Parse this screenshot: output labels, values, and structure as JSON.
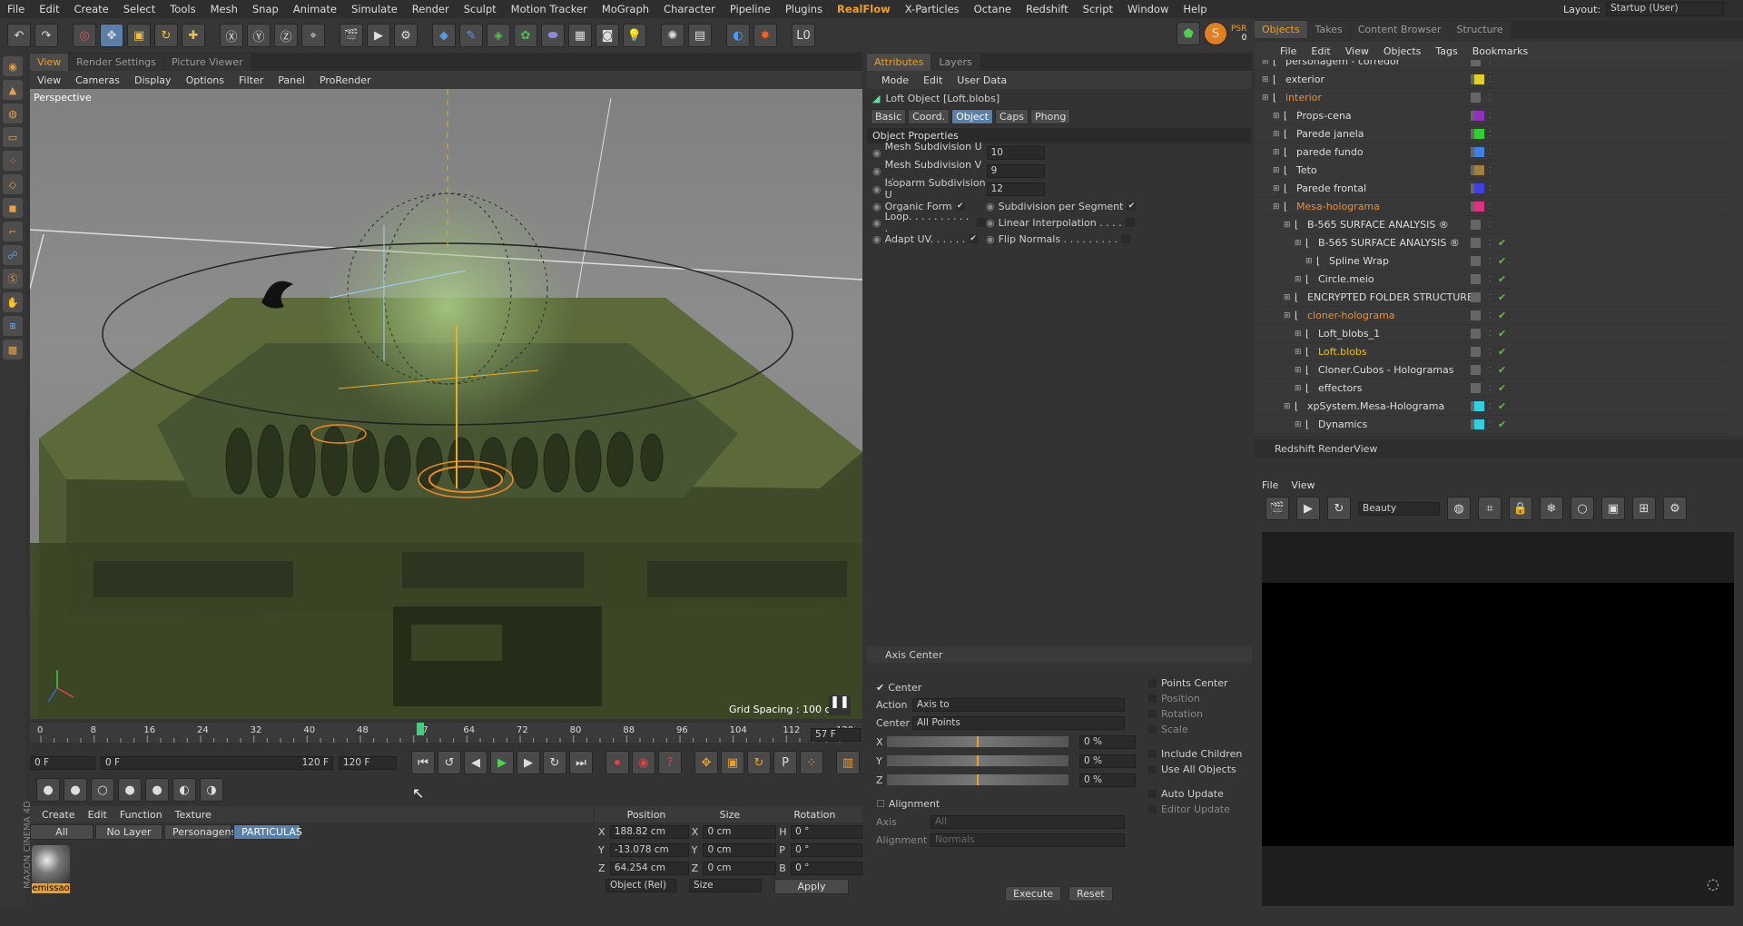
{
  "menu": [
    "File",
    "Edit",
    "Create",
    "Select",
    "Tools",
    "Mesh",
    "Snap",
    "Animate",
    "Simulate",
    "Render",
    "Sculpt",
    "Motion Tracker",
    "MoGraph",
    "Character",
    "Pipeline",
    "Plugins",
    "RealFlow",
    "X-Particles",
    "Octane",
    "Redshift",
    "Script",
    "Window",
    "Help"
  ],
  "layout": {
    "label": "Layout:",
    "value": "Startup (User)"
  },
  "psr": {
    "label": "PSR",
    "value": "0"
  },
  "viewport": {
    "tabs": [
      "View",
      "Render Settings",
      "Picture Viewer"
    ],
    "menu": [
      "View",
      "Cameras",
      "Display",
      "Options",
      "Filter",
      "Panel",
      "ProRender"
    ],
    "name": "Perspective",
    "grid": "Grid Spacing : 100 cm"
  },
  "attributes": {
    "tabs": [
      "Attributes",
      "Layers"
    ],
    "menu": [
      "Mode",
      "Edit",
      "User Data"
    ],
    "title": "Loft Object [Loft.blobs]",
    "subtabs": [
      "Basic",
      "Coord.",
      "Object",
      "Caps",
      "Phong"
    ],
    "section": "Object Properties",
    "fields": [
      {
        "label": "Mesh Subdivision U . .",
        "value": "10"
      },
      {
        "label": "Mesh Subdivision V . .",
        "value": "9"
      },
      {
        "label": "Isoparm Subdivision U",
        "value": "12"
      }
    ],
    "checks": [
      {
        "label": "Organic Form",
        "mark": "✔"
      },
      {
        "label": "Subdivision per Segment",
        "mark": "✔"
      },
      {
        "label": "Loop. . . . . . . . . . .",
        "mark": ""
      },
      {
        "label": "Linear Interpolation . . . .",
        "mark": ""
      },
      {
        "label": "Adapt UV. . . . . .",
        "mark": "✔"
      },
      {
        "label": "Flip Normals . . . . . . . . .",
        "mark": ""
      }
    ]
  },
  "axis": {
    "title": "Axis Center",
    "center": "Center",
    "action_label": "Action",
    "action": "Axis to",
    "center_label": "Center",
    "center_val": "All Points",
    "xyz": [
      "X",
      "Y",
      "Z"
    ],
    "pct": "0 %",
    "alignment": "Alignment",
    "axis_label": "Axis",
    "axis_val": "All",
    "align_label": "Alignment",
    "align_val": "Normals",
    "right": [
      "Points Center",
      "Position",
      "Rotation",
      "Scale",
      "Include Children",
      "Use All Objects",
      "Auto Update",
      "Editor Update"
    ],
    "execute": "Execute",
    "reset": "Reset"
  },
  "objects": {
    "tabs": [
      "Objects",
      "Takes",
      "Content Browser",
      "Structure"
    ],
    "menu": [
      "File",
      "Edit",
      "View",
      "Objects",
      "Tags",
      "Bookmarks"
    ],
    "items": [
      {
        "name": "personagem - corredor",
        "ind": 0,
        "col": "",
        "cls": ""
      },
      {
        "name": "exterior",
        "ind": 0,
        "col": "#e0d020",
        "cls": ""
      },
      {
        "name": "interior",
        "ind": 0,
        "col": "",
        "cls": "orange"
      },
      {
        "name": "Props-cena",
        "ind": 1,
        "col": "#9030c0",
        "cls": ""
      },
      {
        "name": "Parede janela",
        "ind": 1,
        "col": "#30d030",
        "cls": ""
      },
      {
        "name": "parede fundo",
        "ind": 1,
        "col": "#4080e0",
        "cls": ""
      },
      {
        "name": "Teto",
        "ind": 1,
        "col": "#a08040",
        "cls": ""
      },
      {
        "name": "Parede frontal",
        "ind": 1,
        "col": "#4040e0",
        "cls": ""
      },
      {
        "name": "Mesa-holograma",
        "ind": 1,
        "col": "#e03080",
        "cls": "orange"
      },
      {
        "name": "B-565 SURFACE ANALYSIS ®",
        "ind": 2,
        "col": "",
        "cls": ""
      },
      {
        "name": "B-565 SURFACE ANALYSIS ®",
        "ind": 3,
        "col": "",
        "cls": ""
      },
      {
        "name": "Spline Wrap",
        "ind": 4,
        "col": "",
        "cls": ""
      },
      {
        "name": "Circle.meio",
        "ind": 3,
        "col": "",
        "cls": ""
      },
      {
        "name": "ENCRYPTED FOLDER STRUCTURE",
        "ind": 2,
        "col": "",
        "cls": ""
      },
      {
        "name": "cloner-holograma",
        "ind": 2,
        "col": "",
        "cls": "orange"
      },
      {
        "name": "Loft_blobs_1",
        "ind": 3,
        "col": "",
        "cls": ""
      },
      {
        "name": "Loft.blobs",
        "ind": 3,
        "col": "",
        "cls": "yellow"
      },
      {
        "name": "Cloner.Cubos - Hologramas",
        "ind": 3,
        "col": "",
        "cls": ""
      },
      {
        "name": "effectors",
        "ind": 3,
        "col": "",
        "cls": ""
      },
      {
        "name": "xpSystem.Mesa-Holograma",
        "ind": 2,
        "col": "#30d0e0",
        "cls": ""
      },
      {
        "name": "Dynamics",
        "ind": 3,
        "col": "#30d0e0",
        "cls": ""
      }
    ]
  },
  "redshift": {
    "title": "Redshift RenderView",
    "menu": [
      "File",
      "View"
    ],
    "aov": "Beauty"
  },
  "timeline": {
    "ticks": [
      "0",
      "8",
      "16",
      "24",
      "32",
      "40",
      "48",
      "57",
      "64",
      "72",
      "80",
      "88",
      "96",
      "104",
      "112",
      "120"
    ],
    "current": "57 F",
    "start": "0 F",
    "range_start": "0 F",
    "range_end": "120 F",
    "end": "120 F"
  },
  "materials": {
    "menu": [
      "Create",
      "Edit",
      "Function",
      "Texture"
    ],
    "filters": [
      "All",
      "No Layer",
      "Personagens",
      "PARTICULAS"
    ],
    "item": "emissao"
  },
  "coords": {
    "headers": [
      "Position",
      "Size",
      "Rotation"
    ],
    "rows": [
      {
        "a": "X",
        "pos": "188.82 cm",
        "b": "X",
        "size": "0 cm",
        "c": "H",
        "rot": "0 °"
      },
      {
        "a": "Y",
        "pos": "-13.078 cm",
        "b": "Y",
        "size": "0 cm",
        "c": "P",
        "rot": "0 °"
      },
      {
        "a": "Z",
        "pos": "64.254 cm",
        "b": "Z",
        "size": "0 cm",
        "c": "B",
        "rot": "0 °"
      }
    ],
    "mode": "Object (Rel)",
    "size_mode": "Size",
    "apply": "Apply"
  },
  "branding": "MAXON CINEMA 4D"
}
